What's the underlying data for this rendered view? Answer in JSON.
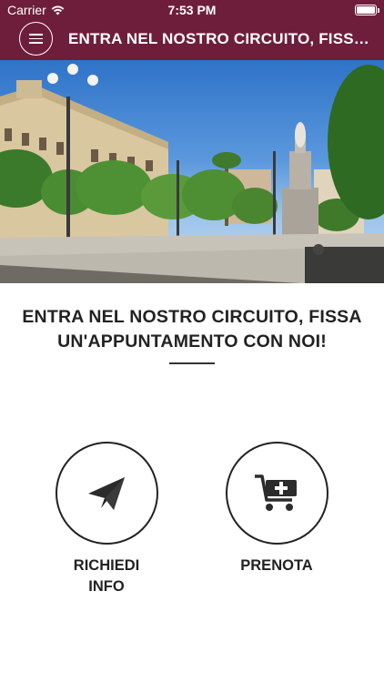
{
  "status_bar": {
    "carrier": "Carrier",
    "time": "7:53 PM"
  },
  "nav": {
    "title": "ENTRA NEL NOSTRO CIRCUITO, FISSA UN'APPUNTAMENTO CON NOI!",
    "menu_icon": "hamburger-icon"
  },
  "hero": {
    "image": "city-square-photo"
  },
  "headline": {
    "line1": "ENTRA NEL NOSTRO CIRCUITO, FISSA",
    "line2": "UN'APPUNTAMENTO CON NOI!"
  },
  "actions": [
    {
      "label_line1": "RICHIEDI",
      "label_line2": "INFO",
      "icon": "paper-plane-icon"
    },
    {
      "label_line1": "PRENOTA",
      "label_line2": "",
      "icon": "cart-add-icon"
    }
  ],
  "colors": {
    "brand": "#6e1e3a",
    "text": "#222222",
    "background": "#ffffff"
  }
}
